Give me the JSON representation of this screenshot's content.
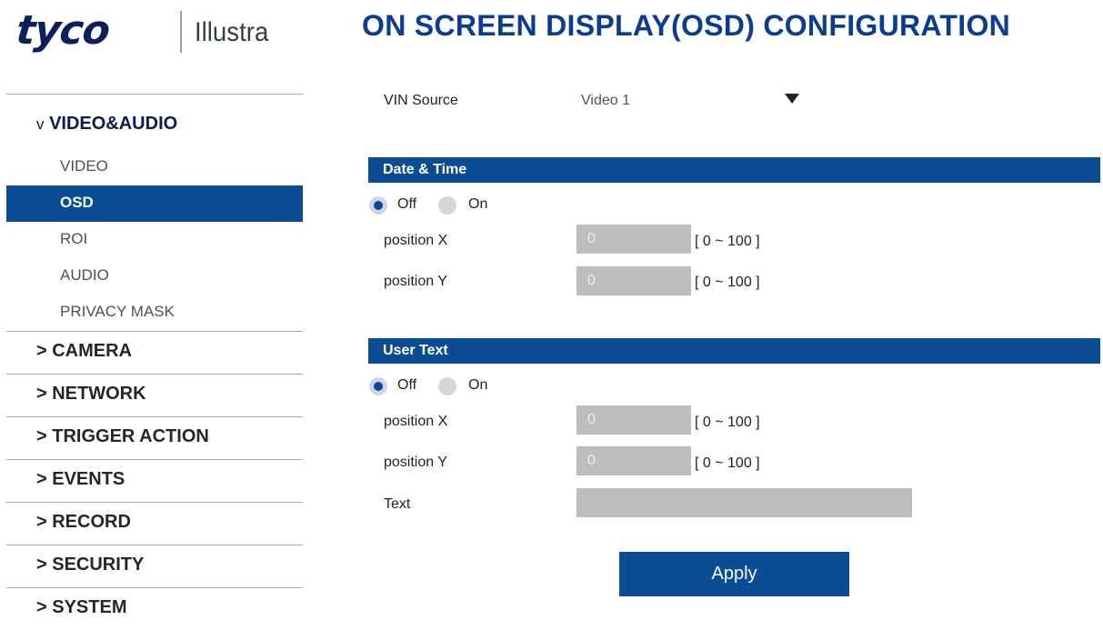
{
  "logo": {
    "brand": "tyco",
    "product": "Illustra"
  },
  "page_title": "ON SCREEN DISPLAY(OSD) CONFIGURATION",
  "sidebar": {
    "open_section": {
      "marker": "v",
      "label": "VIDEO&AUDIO"
    },
    "sub_items": [
      {
        "label": "VIDEO",
        "active": false
      },
      {
        "label": "OSD",
        "active": true
      },
      {
        "label": "ROI",
        "active": false
      },
      {
        "label": "AUDIO",
        "active": false
      },
      {
        "label": "PRIVACY MASK",
        "active": false
      }
    ],
    "sections": [
      "> CAMERA",
      "> NETWORK",
      "> TRIGGER ACTION",
      "> EVENTS",
      "> RECORD",
      "> SECURITY",
      "> SYSTEM"
    ]
  },
  "vin": {
    "label": "VIN Source",
    "value": "Video 1"
  },
  "date_time": {
    "title": "Date & Time",
    "radio_off": "Off",
    "radio_on": "On",
    "selected": "Off",
    "pos_x_label": "position X",
    "pos_x_value": "0",
    "pos_y_label": "position Y",
    "pos_y_value": "0",
    "range": "[ 0 ~ 100 ]"
  },
  "user_text": {
    "title": "User Text",
    "radio_off": "Off",
    "radio_on": "On",
    "selected": "Off",
    "pos_x_label": "position X",
    "pos_x_value": "0",
    "pos_y_label": "position Y",
    "pos_y_value": "0",
    "range": "[ 0 ~ 100 ]",
    "text_label": "Text",
    "text_value": ""
  },
  "apply_label": "Apply",
  "colors": {
    "accent_blue": "#0a4d94",
    "title_blue": "#0a3d8f",
    "input_gray": "#bdbdbd"
  }
}
